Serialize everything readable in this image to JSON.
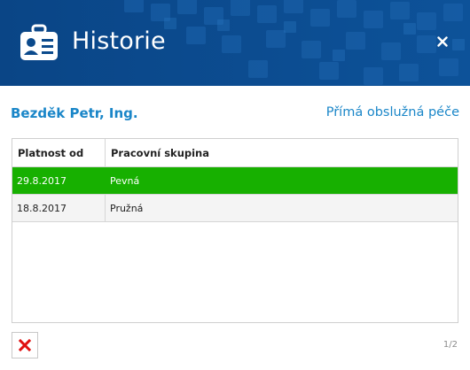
{
  "window": {
    "title": "Historie",
    "header_icon": "id-card-icon",
    "close_icon": "close-icon",
    "colors": {
      "header_bg": "#0b4a8c",
      "accent_text": "#1a86c8",
      "selected_row": "#17b000"
    }
  },
  "person": {
    "name": "Bezděk Petr, Ing.",
    "care_type": "Přímá obslužná péče"
  },
  "table": {
    "columns": [
      "Platnost od",
      "Pracovní skupina"
    ],
    "rows": [
      {
        "platnost_od": "29.8.2017",
        "pracovni_skupina": "Pevná",
        "selected": true
      },
      {
        "platnost_od": "18.8.2017",
        "pracovni_skupina": "Pružná",
        "selected": false
      }
    ]
  },
  "footer": {
    "cancel_icon": "red-x-icon",
    "page_indicator": "1/2"
  }
}
